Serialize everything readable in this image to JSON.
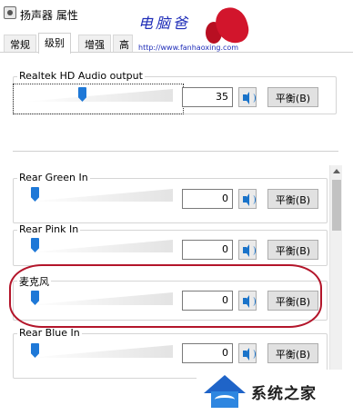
{
  "window": {
    "title": "扬声器 属性",
    "icon": "speaker-properties-icon"
  },
  "tabs": [
    {
      "label": "常规",
      "active": false
    },
    {
      "label": "级别",
      "active": true
    },
    {
      "label": "增强",
      "active": false
    },
    {
      "label": "高",
      "active": false
    }
  ],
  "watermark": {
    "text": "电脑爸",
    "url": "http://www.fanhaoxing.com",
    "logo_text": "系统之家"
  },
  "master": {
    "label": "Realtek HD Audio output",
    "value": "35",
    "level_percent": 35,
    "balance_label": "平衡(B)"
  },
  "channels": [
    {
      "label": "Rear Green In",
      "value": "0",
      "level_percent": 0,
      "balance_label": "平衡(B)"
    },
    {
      "label": "Rear Pink In",
      "value": "0",
      "level_percent": 0,
      "balance_label": "平衡(B)"
    },
    {
      "label": "麦克风",
      "value": "0",
      "level_percent": 0,
      "balance_label": "平衡(B)",
      "highlighted": true
    },
    {
      "label": "Rear Blue In",
      "value": "0",
      "level_percent": 0,
      "balance_label": "平衡(B)"
    }
  ],
  "colors": {
    "slider_thumb": "#1e78d7",
    "highlight_ring": "#b3152a",
    "speaker_icon": "#1a73c9"
  }
}
